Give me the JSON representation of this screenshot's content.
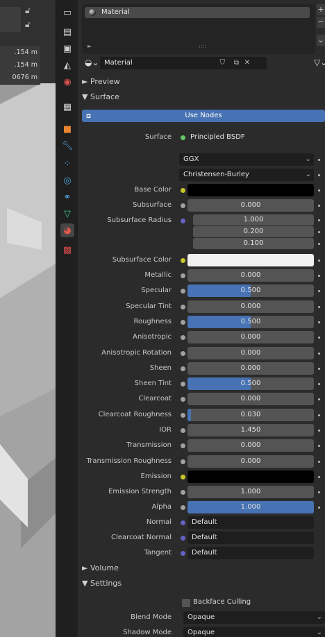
{
  "viewport": {
    "dimensions": [
      ".154 m",
      ".154 m",
      "0676 m"
    ]
  },
  "material_slots": {
    "items": [
      "Material"
    ]
  },
  "material_selector": {
    "name": "Material"
  },
  "sections": {
    "preview": "Preview",
    "surface": "Surface",
    "volume": "Volume",
    "settings": "Settings"
  },
  "use_nodes_label": "Use Nodes",
  "surface": {
    "label": "Surface",
    "shader": "Principled BSDF",
    "distribution": "GGX",
    "subsurface_method": "Christensen-Burley"
  },
  "properties": [
    {
      "label": "Subsurface",
      "value": "0.000",
      "fraction": 0
    },
    {
      "label": "Metallic",
      "value": "0.000",
      "fraction": 0
    },
    {
      "label": "Specular",
      "value": "0.500",
      "fraction": 0.5
    },
    {
      "label": "Specular Tint",
      "value": "0.000",
      "fraction": 0
    },
    {
      "label": "Roughness",
      "value": "0.500",
      "fraction": 0.5
    },
    {
      "label": "Anisotropic",
      "value": "0.000",
      "fraction": 0
    },
    {
      "label": "Anisotropic Rotation",
      "value": "0.000",
      "fraction": 0
    },
    {
      "label": "Sheen",
      "value": "0.000",
      "fraction": 0
    },
    {
      "label": "Sheen Tint",
      "value": "0.500",
      "fraction": 0.5
    },
    {
      "label": "Clearcoat",
      "value": "0.000",
      "fraction": 0
    },
    {
      "label": "Clearcoat Roughness",
      "value": "0.030",
      "fraction": 0.03
    },
    {
      "label": "IOR",
      "value": "1.450",
      "fraction": 0
    },
    {
      "label": "Transmission",
      "value": "0.000",
      "fraction": 0
    },
    {
      "label": "Transmission Roughness",
      "value": "0.000",
      "fraction": 0
    },
    {
      "label": "Emission Strength",
      "value": "1.000",
      "fraction": 0
    },
    {
      "label": "Alpha",
      "value": "1.000",
      "fraction": 1
    }
  ],
  "base_color": {
    "label": "Base Color",
    "color": "#000000"
  },
  "subsurface_radius": {
    "label": "Subsurface Radius",
    "values": [
      "1.000",
      "0.200",
      "0.100"
    ]
  },
  "subsurface_color": {
    "label": "Subsurface Color",
    "color": "#f0f0f0"
  },
  "emission": {
    "label": "Emission",
    "color": "#000000"
  },
  "vectors": [
    {
      "label": "Normal",
      "value": "Default"
    },
    {
      "label": "Clearcoat Normal",
      "value": "Default"
    },
    {
      "label": "Tangent",
      "value": "Default"
    }
  ],
  "settings": {
    "backface_culling": "Backface Culling",
    "blend_mode_label": "Blend Mode",
    "blend_mode": "Opaque",
    "shadow_mode_label": "Shadow Mode",
    "shadow_mode": "Opaque"
  },
  "colors": {
    "accent": "#4772b3",
    "socket_float": "#a1a1a1",
    "socket_color": "#c7c729",
    "socket_vector": "#6363c7",
    "socket_shader": "#63c763"
  }
}
